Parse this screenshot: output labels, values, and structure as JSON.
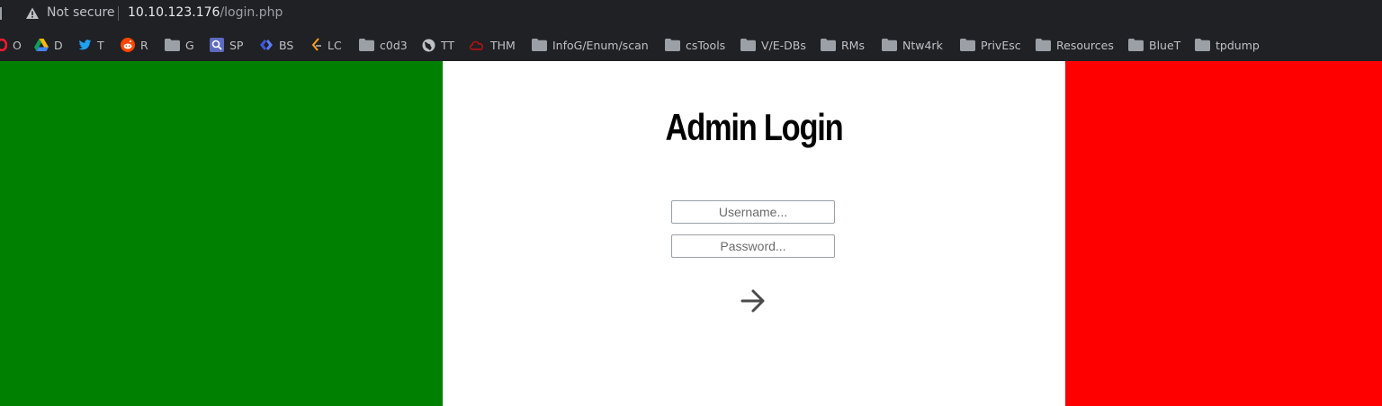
{
  "browser": {
    "security_label": "Not secure",
    "url_host": "10.10.123.176",
    "url_path": "/login.php",
    "warning_icon": "warning-triangle-icon"
  },
  "bookmarks": [
    {
      "label": "O",
      "icon": "opera-icon"
    },
    {
      "label": "D",
      "icon": "google-drive-icon"
    },
    {
      "label": "T",
      "icon": "twitter-icon"
    },
    {
      "label": "R",
      "icon": "reddit-icon"
    },
    {
      "label": "G",
      "icon": "folder-icon"
    },
    {
      "label": "SP",
      "icon": "search-icon"
    },
    {
      "label": "BS",
      "icon": "bs-icon"
    },
    {
      "label": "LC",
      "icon": "leetcode-icon"
    },
    {
      "label": "c0d3",
      "icon": "folder-icon"
    },
    {
      "label": "TT",
      "icon": "globe-icon"
    },
    {
      "label": "THM",
      "icon": "tryhackme-icon"
    },
    {
      "label": "InfoG/Enum/scan",
      "icon": "folder-icon"
    },
    {
      "label": "csTools",
      "icon": "folder-icon"
    },
    {
      "label": "V/E-DBs",
      "icon": "folder-icon"
    },
    {
      "label": "RMs",
      "icon": "folder-icon"
    },
    {
      "label": "Ntw4rk",
      "icon": "folder-icon"
    },
    {
      "label": "PrivEsc",
      "icon": "folder-icon"
    },
    {
      "label": "Resources",
      "icon": "folder-icon"
    },
    {
      "label": "BlueT",
      "icon": "folder-icon"
    },
    {
      "label": "tpdump",
      "icon": "folder-icon"
    }
  ],
  "page": {
    "title": "Admin Login",
    "username_placeholder": "Username...",
    "password_placeholder": "Password...",
    "submit_icon": "arrow-right-icon",
    "colors": {
      "left": "#008000",
      "middle": "#ffffff",
      "right": "#ff0000"
    }
  }
}
